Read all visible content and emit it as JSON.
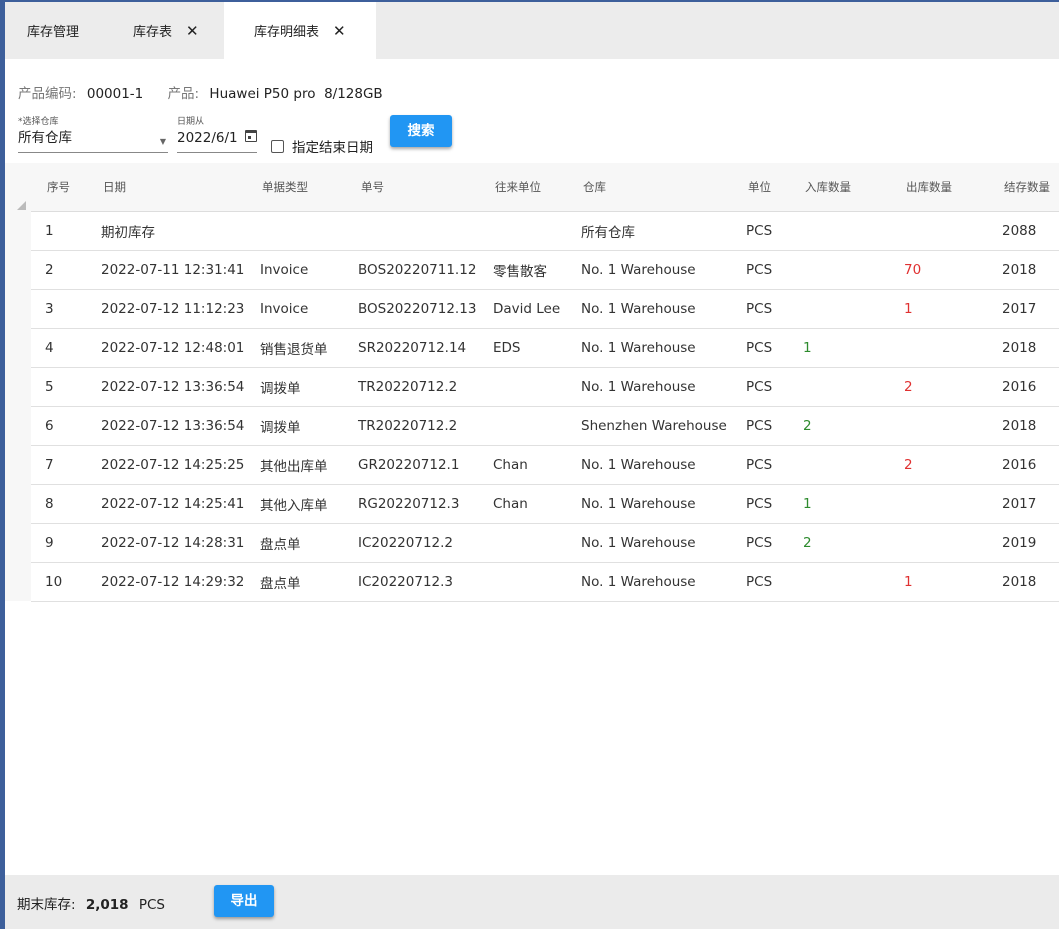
{
  "tabs": [
    {
      "label": "库存管理",
      "closable": false,
      "active": false
    },
    {
      "label": "库存表",
      "closable": true,
      "active": false
    },
    {
      "label": "库存明细表",
      "closable": true,
      "active": true
    }
  ],
  "info": {
    "code_label": "产品编码:",
    "code_value": "00001-1",
    "product_label": "产品:",
    "product_value": "Huawei P50 pro  8/128GB"
  },
  "filters": {
    "warehouse_label": "*选择仓库",
    "warehouse_value": "所有仓库",
    "date_label": "日期从",
    "date_value": "2022/6/1",
    "end_date_checkbox": "指定结束日期",
    "end_date_checked": false,
    "search_button": "搜索"
  },
  "table": {
    "headers": [
      "序号",
      "日期",
      "单据类型",
      "单号",
      "往来单位",
      "仓库",
      "单位",
      "入库数量",
      "出库数量",
      "结存数量"
    ],
    "rows": [
      [
        "1",
        "期初库存",
        "",
        "",
        "",
        "所有仓库",
        "PCS",
        "",
        "",
        "2088"
      ],
      [
        "2",
        "2022-07-11 12:31:41",
        "Invoice",
        "BOS20220711.12",
        "零售散客",
        "No. 1 Warehouse",
        "PCS",
        "",
        "70",
        "2018"
      ],
      [
        "3",
        "2022-07-12 11:12:23",
        "Invoice",
        "BOS20220712.13",
        "David Lee",
        "No. 1 Warehouse",
        "PCS",
        "",
        "1",
        "2017"
      ],
      [
        "4",
        "2022-07-12 12:48:01",
        "销售退货单",
        "SR20220712.14",
        "EDS",
        "No. 1 Warehouse",
        "PCS",
        "1",
        "",
        "2018"
      ],
      [
        "5",
        "2022-07-12 13:36:54",
        "调拨单",
        "TR20220712.2",
        "",
        "No. 1 Warehouse",
        "PCS",
        "",
        "2",
        "2016"
      ],
      [
        "6",
        "2022-07-12 13:36:54",
        "调拨单",
        "TR20220712.2",
        "",
        "Shenzhen Warehouse",
        "PCS",
        "2",
        "",
        "2018"
      ],
      [
        "7",
        "2022-07-12 14:25:25",
        "其他出库单",
        "GR20220712.1",
        "Chan",
        "No. 1 Warehouse",
        "PCS",
        "",
        "2",
        "2016"
      ],
      [
        "8",
        "2022-07-12 14:25:41",
        "其他入库单",
        "RG20220712.3",
        "Chan",
        "No. 1 Warehouse",
        "PCS",
        "1",
        "",
        "2017"
      ],
      [
        "9",
        "2022-07-12 14:28:31",
        "盘点单",
        "IC20220712.2",
        "",
        "No. 1 Warehouse",
        "PCS",
        "2",
        "",
        "2019"
      ],
      [
        "10",
        "2022-07-12 14:29:32",
        "盘点单",
        "IC20220712.3",
        "",
        "No. 1 Warehouse",
        "PCS",
        "",
        "1",
        "2018"
      ]
    ]
  },
  "footer": {
    "label": "期末库存:",
    "value": "2,018",
    "unit": "PCS",
    "export_button": "导出"
  },
  "colors": {
    "in_qty": "#2e8b2e",
    "out_qty": "#e03131",
    "button": "#2196f3",
    "frame": "#3d5f9b"
  },
  "icons": {
    "close": "close-icon",
    "dropdown": "chevron-down-icon",
    "calendar": "calendar-icon",
    "checkbox": "checkbox-icon"
  }
}
